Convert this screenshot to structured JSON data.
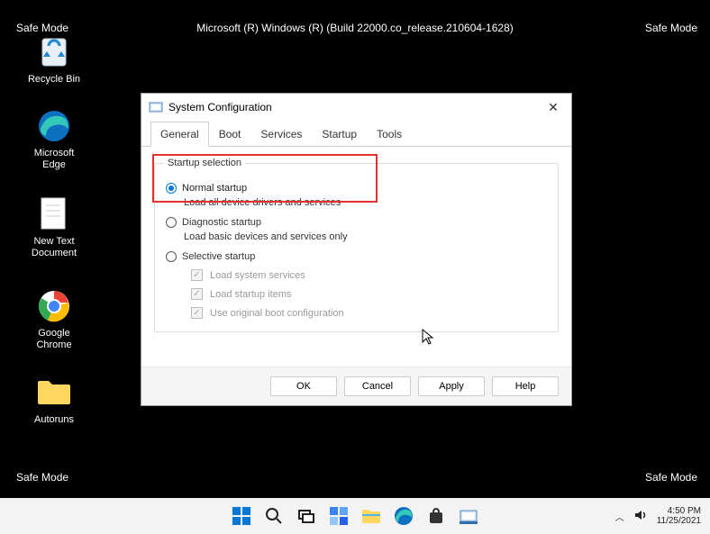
{
  "corners": {
    "tl": "Safe Mode",
    "tr": "Safe Mode",
    "bl": "Safe Mode",
    "br": "Safe Mode"
  },
  "headerCenter": "Microsoft (R) Windows (R) (Build 22000.co_release.210604-1628)",
  "desktopIcons": {
    "recycle": "Recycle Bin",
    "edge": "Microsoft Edge",
    "text": "New Text Document",
    "chrome": "Google Chrome",
    "autoruns": "Autoruns"
  },
  "dialog": {
    "title": "System Configuration",
    "tabs": [
      "General",
      "Boot",
      "Services",
      "Startup",
      "Tools"
    ],
    "activeTab": 0,
    "legend": "Startup selection",
    "options": {
      "normal": {
        "label": "Normal startup",
        "desc": "Load all device drivers and services"
      },
      "diag": {
        "label": "Diagnostic startup",
        "desc": "Load basic devices and services only"
      },
      "selective": {
        "label": "Selective startup"
      }
    },
    "subChecks": {
      "sys": "Load system services",
      "startup": "Load startup items",
      "boot": "Use original boot configuration"
    },
    "buttons": {
      "ok": "OK",
      "cancel": "Cancel",
      "apply": "Apply",
      "help": "Help"
    }
  },
  "taskbar": {
    "time": "4:50 PM",
    "date": "11/25/2021"
  }
}
